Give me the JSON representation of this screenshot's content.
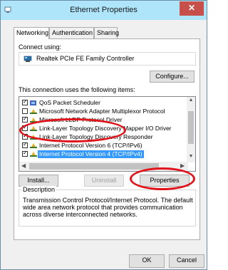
{
  "window": {
    "title": "Ethernet Properties",
    "close_label": "✕"
  },
  "tabs": [
    {
      "label": "Networking"
    },
    {
      "label": "Authentication"
    },
    {
      "label": "Sharing"
    }
  ],
  "networking": {
    "connect_using_label": "Connect using:",
    "adapter_name": "Realtek PCIe FE Family Controller",
    "configure_label": "Configure...",
    "items_label": "This connection uses the following items:",
    "items": [
      {
        "label": "QoS Packet Scheduler",
        "checked": true,
        "icon": "qos-icon"
      },
      {
        "label": "Microsoft Network Adapter Multiplexor Protocol",
        "checked": false,
        "icon": "protocol-icon"
      },
      {
        "label": "Microsoft LLDP Protocol Driver",
        "checked": true,
        "icon": "protocol-icon"
      },
      {
        "label": "Link-Layer Topology Discovery Mapper I/O Driver",
        "checked": true,
        "icon": "protocol-icon"
      },
      {
        "label": "Link-Layer Topology Discovery Responder",
        "checked": true,
        "icon": "protocol-icon"
      },
      {
        "label": "Internet Protocol Version 6 (TCP/IPv6)",
        "checked": true,
        "icon": "protocol-icon"
      },
      {
        "label": "Internet Protocol Version 4 (TCP/IPv4)",
        "checked": true,
        "icon": "protocol-icon",
        "selected": true
      }
    ],
    "install_label": "Install...",
    "uninstall_label": "Uninstall",
    "properties_label": "Properties",
    "description_legend": "Description",
    "description_text": "Transmission Control Protocol/Internet Protocol. The default wide area network protocol that provides communication across diverse interconnected networks."
  },
  "footer": {
    "ok_label": "OK",
    "cancel_label": "Cancel"
  },
  "colors": {
    "titlebar": "#aee5fb",
    "close": "#c7504a",
    "selection": "#3399ff",
    "annotation": "#e0141a"
  }
}
